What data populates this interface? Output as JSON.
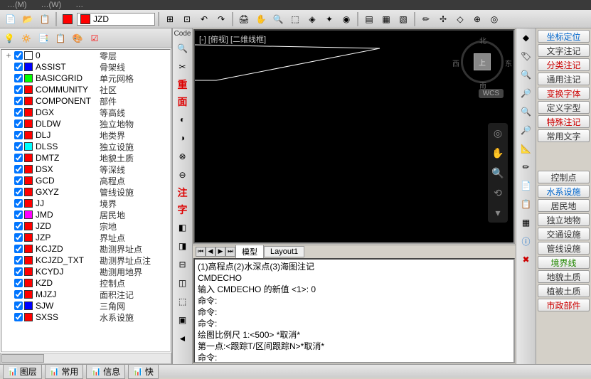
{
  "menubar": [
    "…(W)",
    "…",
    ""
  ],
  "layer_current": "JZD",
  "layers": [
    {
      "c": "#ffffff",
      "n": "0",
      "d": "零层",
      "exp": "+"
    },
    {
      "c": "#0000ff",
      "n": "ASSIST",
      "d": "骨架线"
    },
    {
      "c": "#00ff00",
      "n": "BASICGRID",
      "d": "单元网格"
    },
    {
      "c": "#ff0000",
      "n": "COMMUNITY",
      "d": "社区"
    },
    {
      "c": "#ff0000",
      "n": "COMPONENT",
      "d": "部件"
    },
    {
      "c": "#ff0000",
      "n": "DGX",
      "d": "等高线"
    },
    {
      "c": "#ff0000",
      "n": "DLDW",
      "d": "独立地物"
    },
    {
      "c": "#ff0000",
      "n": "DLJ",
      "d": "地类界"
    },
    {
      "c": "#00ffff",
      "n": "DLSS",
      "d": "独立设施"
    },
    {
      "c": "#ff0000",
      "n": "DMTZ",
      "d": "地貌土质"
    },
    {
      "c": "#ff0000",
      "n": "DSX",
      "d": "等深线"
    },
    {
      "c": "#ff0000",
      "n": "GCD",
      "d": "高程点"
    },
    {
      "c": "#ff0000",
      "n": "GXYZ",
      "d": "管线设施"
    },
    {
      "c": "#ff0000",
      "n": "JJ",
      "d": "境界"
    },
    {
      "c": "#ff00ff",
      "n": "JMD",
      "d": "居民地"
    },
    {
      "c": "#ff0000",
      "n": "JZD",
      "d": "宗地"
    },
    {
      "c": "#ff0000",
      "n": "JZP",
      "d": "界址点"
    },
    {
      "c": "#ff0000",
      "n": "KCJZD",
      "d": "勘测界址点"
    },
    {
      "c": "#ff0000",
      "n": "KCJZD_TXT",
      "d": "勘测界址点注"
    },
    {
      "c": "#ff0000",
      "n": "KCYDJ",
      "d": "勘测用地界"
    },
    {
      "c": "#ff0000",
      "n": "KZD",
      "d": "控制点"
    },
    {
      "c": "#ff0000",
      "n": "MJZJ",
      "d": "面积注记"
    },
    {
      "c": "#0000ff",
      "n": "SJW",
      "d": "三角网"
    },
    {
      "c": "#ff0000",
      "n": "SXSS",
      "d": "水系设施"
    }
  ],
  "vert_tabs": {
    "code": "Code",
    "chars": [
      "重",
      "面",
      "注",
      "字"
    ]
  },
  "canvas": {
    "label": "[-] [俯视] [二维线框]",
    "compass": {
      "n": "北",
      "e": "东",
      "s": "南",
      "w": "西",
      "top": "上"
    },
    "wcs": "WCS"
  },
  "model_tabs": [
    "模型",
    "Layout1"
  ],
  "cmd_lines": [
    "(1)高程点(2)水深点(3)海图注记",
    "CMDECHO",
    "输入 CMDECHO 的新值 <1>: 0",
    "命令:",
    "命令:",
    "命令:",
    "绘图比例尺 1:<500> *取消*",
    "第一点:<跟踪T/区间跟踪N>*取消*",
    "命令:"
  ],
  "right_panel": [
    {
      "t": "坐标定位",
      "c": "blue"
    },
    {
      "t": "文字注记",
      "c": ""
    },
    {
      "t": "分类注记",
      "c": "red"
    },
    {
      "t": "通用注记",
      "c": ""
    },
    {
      "t": "变换字体",
      "c": "red"
    },
    {
      "t": "定义字型",
      "c": ""
    },
    {
      "t": "特殊注记",
      "c": "red"
    },
    {
      "t": "常用文字",
      "c": ""
    },
    {
      "gap": true
    },
    {
      "t": "控制点",
      "c": ""
    },
    {
      "t": "水系设施",
      "c": "blue"
    },
    {
      "t": "居民地",
      "c": ""
    },
    {
      "t": "独立地物",
      "c": ""
    },
    {
      "t": "交通设施",
      "c": ""
    },
    {
      "t": "管线设施",
      "c": ""
    },
    {
      "t": "境界线",
      "c": "green"
    },
    {
      "t": "地貌土质",
      "c": ""
    },
    {
      "t": "植被土质",
      "c": ""
    },
    {
      "t": "市政部件",
      "c": "red"
    }
  ],
  "bottom_tabs": [
    "图层",
    "常用",
    "信息",
    "快"
  ]
}
